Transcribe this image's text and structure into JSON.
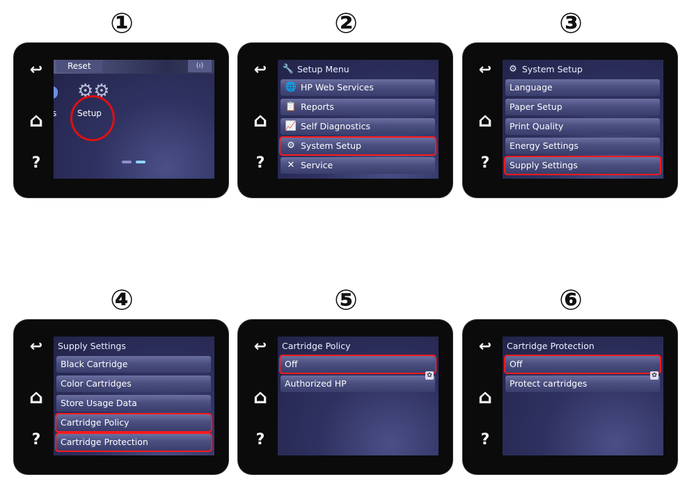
{
  "steps": [
    "①",
    "②",
    "③",
    "④",
    "⑤",
    "⑥"
  ],
  "nav": {
    "back_icon": "↩",
    "home_icon": "⌂",
    "help_label": "?"
  },
  "highlight_color": "#ff1a1a",
  "panel1": {
    "reset_label": "Reset",
    "wireless_icon": "(ı)",
    "partial_label": "s",
    "setup_label": "Setup",
    "page_indicator": {
      "pages": 2,
      "current": 2
    }
  },
  "panel2": {
    "title": "Setup Menu",
    "items": [
      "HP Web Services",
      "Reports",
      "Self Diagnostics",
      "System Setup",
      "Service"
    ],
    "highlighted": "System Setup"
  },
  "panel3": {
    "title": "System Setup",
    "items": [
      "Language",
      "Paper Setup",
      "Print Quality",
      "Energy Settings",
      "Supply Settings"
    ],
    "highlighted": "Supply Settings"
  },
  "panel4": {
    "title": "Supply Settings",
    "items": [
      "Black Cartridge",
      "Color Cartridges",
      "Store Usage Data",
      "Cartridge Policy",
      "Cartridge Protection"
    ],
    "highlighted": [
      "Cartridge Policy",
      "Cartridge Protection"
    ]
  },
  "panel5": {
    "title": "Cartridge Policy",
    "items": [
      "Off",
      "Authorized HP"
    ],
    "highlighted": "Off",
    "selected": "Authorized HP"
  },
  "panel6": {
    "title": "Cartridge Protection",
    "items": [
      "Off",
      "Protect cartridges"
    ],
    "highlighted": "Off",
    "selected": "Protect cartridges"
  }
}
